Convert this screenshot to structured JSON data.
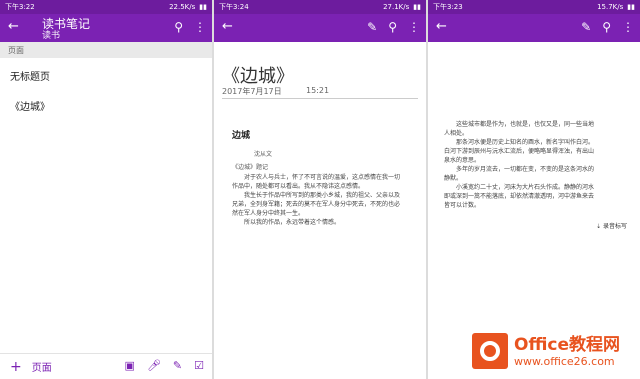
{
  "panel1": {
    "status": {
      "time": "下午3:22",
      "speed": "22.5K/s"
    },
    "title": "读书笔记",
    "subtitle": "读书",
    "section_header": "页面",
    "pages": [
      "无标题页",
      "《边城》"
    ],
    "bottom": {
      "add_label": "+",
      "page_label": "页面"
    }
  },
  "panel2": {
    "status": {
      "time": "下午3:24",
      "speed": "27.1K/s"
    },
    "note_title": "《边城》",
    "date": "2017年7月17日",
    "time": "15:21",
    "book_title": "边城",
    "author": "沈从文",
    "subheading": "《边城》题记",
    "paragraphs": [
      "对于农人与兵士，怀了不可言说的温爱，这点感情在我一切作品中，随处都可以看出。我从不隐讳这点感情。",
      "我生长于作品中所写到的那类小乡城，我的祖父、父亲以及兄弟，全列身军籍；死去的莫不在军人身分中死去，不死的也必然在军人身分中终其一生。",
      "所以我的作品，永远带着这个情感。"
    ]
  },
  "panel3": {
    "status": {
      "time": "下午3:23",
      "speed": "15.7K/s"
    },
    "paragraphs": [
      "这些城市都是作为，也就是，也仅又是，同一些当地人相处。",
      "那条河水便是历史上知名的酉水，新名字叫作白河。白河下游到辰州与沅水汇流后，便略略显得浑浊，有出山泉水的意思。",
      "多年的岁月流去，一切都在变，不变的是这条河水的静默。",
      "小溪宽约二十丈，河床为大片石头作成。静静的河水即或深到一篙不能落底，却依然清澈透明，河中游鱼来去皆可以计数。"
    ],
    "side_note": "录音标写"
  },
  "watermark": {
    "logo": "Office教程网",
    "url": "www.office26.com"
  }
}
